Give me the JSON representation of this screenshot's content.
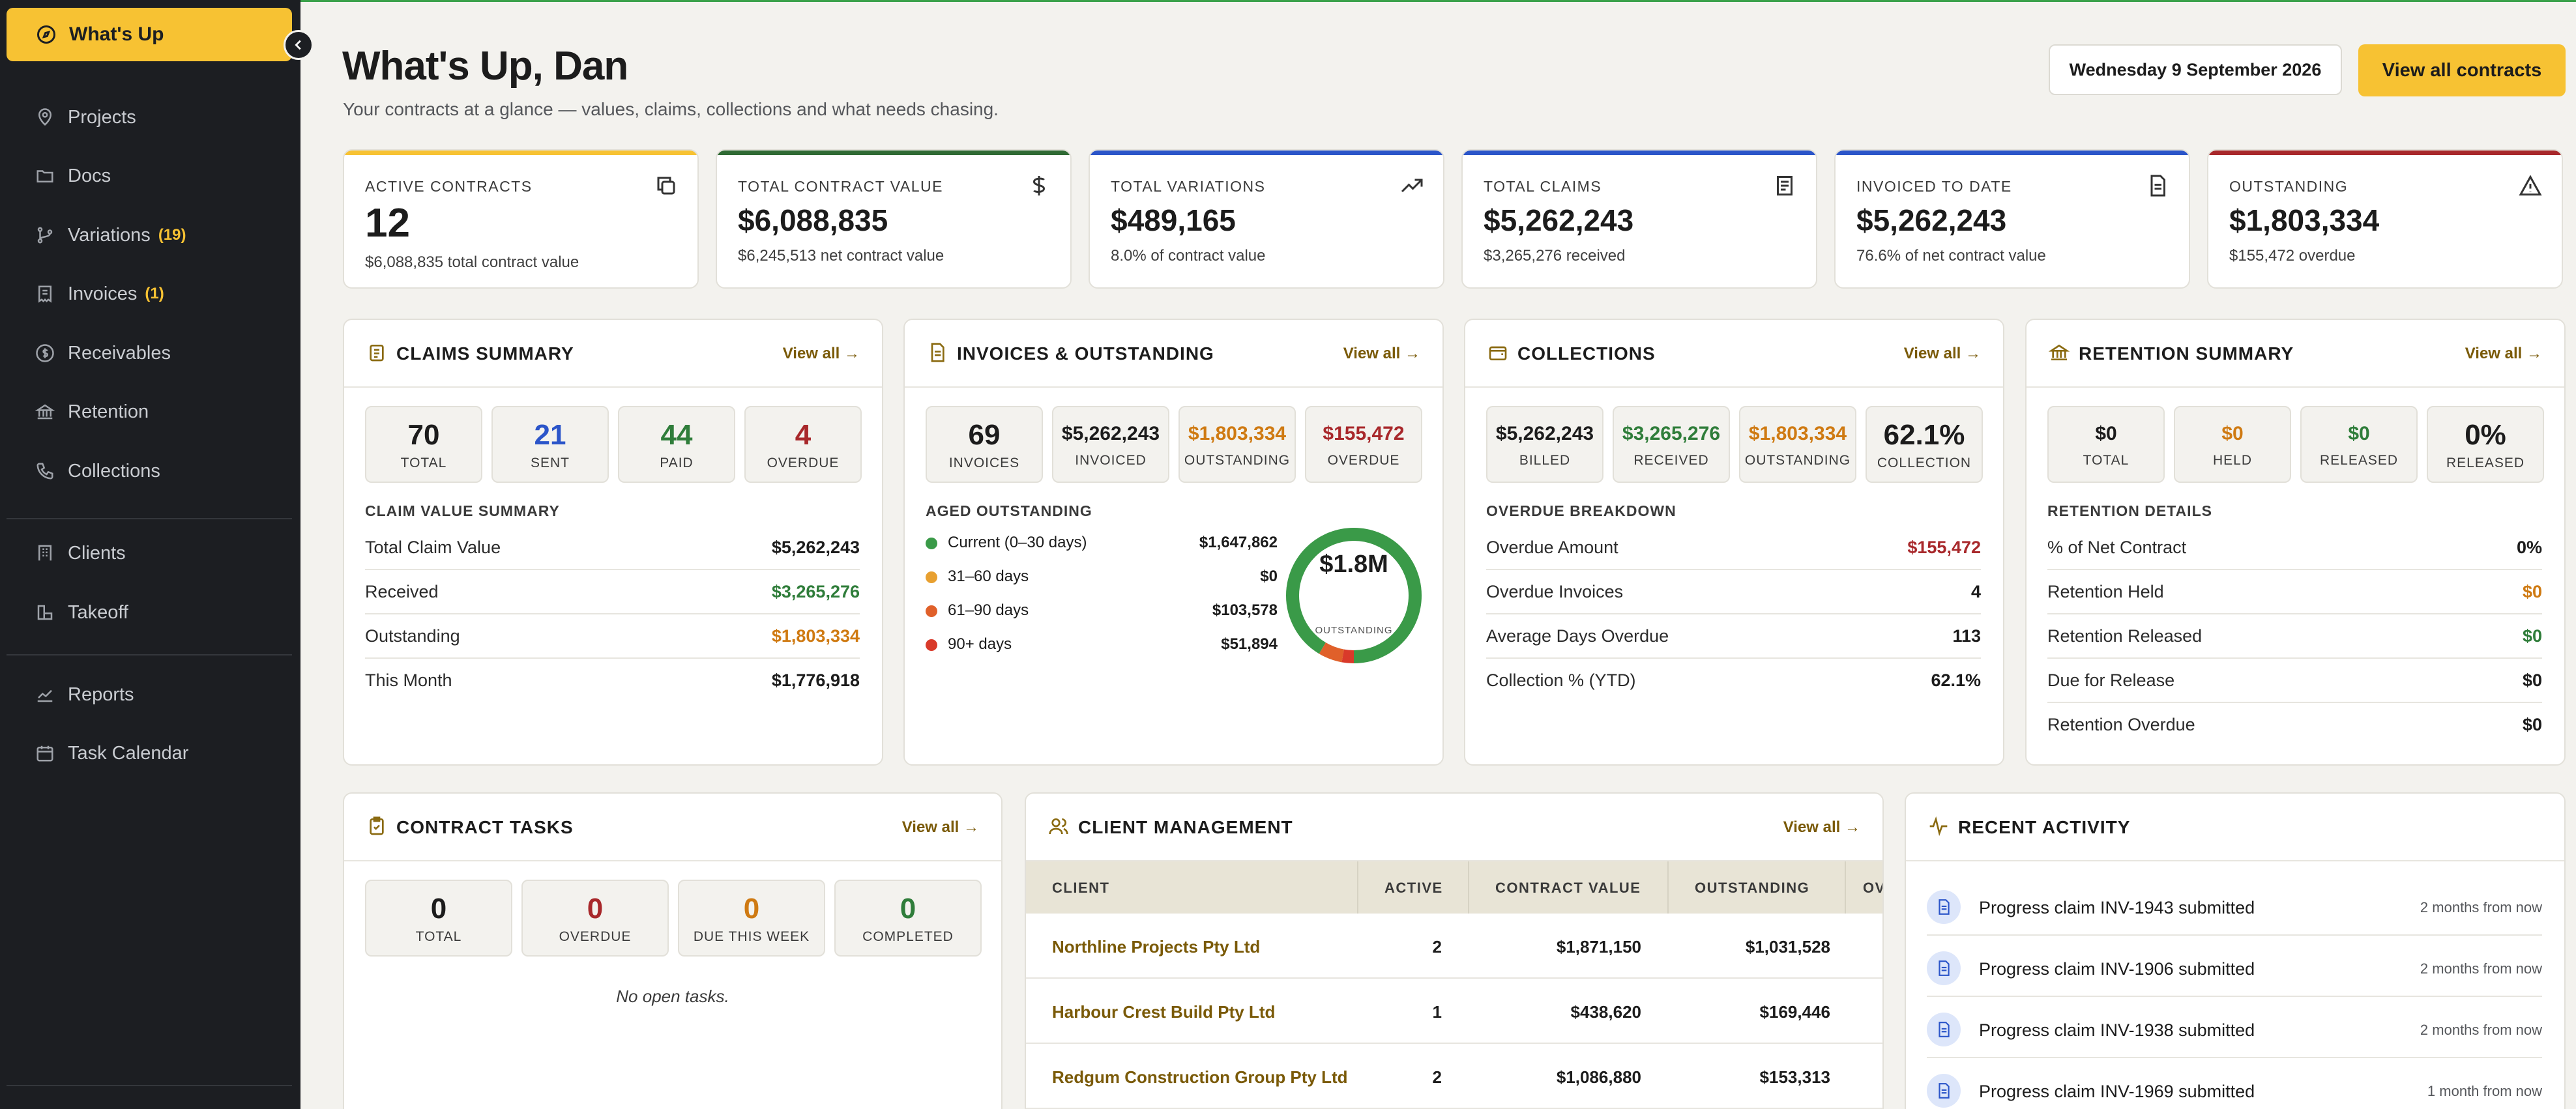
{
  "sidebar": {
    "active": {
      "label": "What's Up",
      "icon": "compass-icon"
    },
    "items": [
      {
        "label": "Projects",
        "icon": "map-pin-icon",
        "badge": ""
      },
      {
        "label": "Docs",
        "icon": "folder-icon",
        "badge": ""
      },
      {
        "label": "Variations",
        "icon": "git-branch-icon",
        "badge": "(19)"
      },
      {
        "label": "Invoices",
        "icon": "receipt-icon",
        "badge": "(1)"
      },
      {
        "label": "Receivables",
        "icon": "dollar-circle-icon",
        "badge": ""
      },
      {
        "label": "Retention",
        "icon": "bank-icon",
        "badge": ""
      },
      {
        "label": "Collections",
        "icon": "phone-icon",
        "badge": ""
      },
      {
        "label": "Clients",
        "icon": "building-icon",
        "badge": ""
      },
      {
        "label": "Takeoff",
        "icon": "ruler-icon",
        "badge": ""
      },
      {
        "label": "Reports",
        "icon": "chart-line-icon",
        "badge": ""
      },
      {
        "label": "Task Calendar",
        "icon": "calendar-icon",
        "badge": ""
      }
    ]
  },
  "header": {
    "title": "What's Up, Dan",
    "subtitle": "Your contracts at a glance — values, claims, collections and what needs chasing.",
    "date": "Wednesday 9 September 2026",
    "cta": "View all contracts"
  },
  "stats": [
    {
      "label": "ACTIVE CONTRACTS",
      "value": "12",
      "sub": "$6,088,835 total contract value",
      "color": "#f7c233"
    },
    {
      "label": "TOTAL CONTRACT VALUE",
      "value": "$6,088,835",
      "sub": "$6,245,513 net contract value",
      "color": "#2f6a34"
    },
    {
      "label": "TOTAL VARIATIONS",
      "value": "$489,165",
      "sub": "8.0% of contract value",
      "color": "#2b55c9"
    },
    {
      "label": "TOTAL CLAIMS",
      "value": "$5,262,243",
      "sub": "$3,265,276 received",
      "color": "#2b55c9"
    },
    {
      "label": "INVOICED TO DATE",
      "value": "$5,262,243",
      "sub": "76.6% of net contract value",
      "color": "#2b55c9"
    },
    {
      "label": "OUTSTANDING",
      "value": "$1,803,334",
      "sub": "$155,472 overdue",
      "color": "#a8282b"
    }
  ],
  "claims": {
    "title": "CLAIMS SUMMARY",
    "view_all": "View all →",
    "tiles": [
      {
        "n": "70",
        "c": "TOTAL"
      },
      {
        "n": "21",
        "c": "SENT"
      },
      {
        "n": "44",
        "c": "PAID"
      },
      {
        "n": "4",
        "c": "OVERDUE"
      }
    ],
    "section": "CLAIM VALUE SUMMARY",
    "rows": [
      {
        "k": "Total Claim Value",
        "v": "$5,262,243"
      },
      {
        "k": "Received",
        "v": "$3,265,276"
      },
      {
        "k": "Outstanding",
        "v": "$1,803,334"
      },
      {
        "k": "This Month",
        "v": "$1,776,918"
      }
    ]
  },
  "invoices": {
    "title": "INVOICES & OUTSTANDING",
    "view_all": "View all →",
    "tiles": [
      {
        "n": "69",
        "c": "INVOICES"
      },
      {
        "n": "$5,262,243",
        "c": "INVOICED"
      },
      {
        "n": "$1,803,334",
        "c": "OUTSTANDING"
      },
      {
        "n": "$155,472",
        "c": "OVERDUE"
      }
    ],
    "section": "AGED OUTSTANDING",
    "aged": [
      {
        "k": "Current (0–30 days)",
        "v": "$1,647,862",
        "color": "#3a9a48"
      },
      {
        "k": "31–60 days",
        "v": "$0",
        "color": "#e8a030"
      },
      {
        "k": "61–90 days",
        "v": "$103,578",
        "color": "#e0602a"
      },
      {
        "k": "90+ days",
        "v": "$51,894",
        "color": "#d93a2a"
      }
    ],
    "donut_value": "$1.8M",
    "donut_label": "OUTSTANDING"
  },
  "collections": {
    "title": "COLLECTIONS",
    "view_all": "View all →",
    "tiles": [
      {
        "n": "$5,262,243",
        "c": "BILLED"
      },
      {
        "n": "$3,265,276",
        "c": "RECEIVED"
      },
      {
        "n": "$1,803,334",
        "c": "OUTSTANDING"
      },
      {
        "n": "62.1%",
        "c": "COLLECTION"
      }
    ],
    "section": "OVERDUE BREAKDOWN",
    "rows": [
      {
        "k": "Overdue Amount",
        "v": "$155,472"
      },
      {
        "k": "Overdue Invoices",
        "v": "4"
      },
      {
        "k": "Average Days Overdue",
        "v": "113"
      },
      {
        "k": "Collection % (YTD)",
        "v": "62.1%"
      }
    ]
  },
  "retention": {
    "title": "RETENTION SUMMARY",
    "view_all": "View all →",
    "tiles": [
      {
        "n": "$0",
        "c": "TOTAL"
      },
      {
        "n": "$0",
        "c": "HELD"
      },
      {
        "n": "$0",
        "c": "RELEASED"
      },
      {
        "n": "0%",
        "c": "RELEASED"
      }
    ],
    "section": "RETENTION DETAILS",
    "rows": [
      {
        "k": "% of Net Contract",
        "v": "0%"
      },
      {
        "k": "Retention Held",
        "v": "$0"
      },
      {
        "k": "Retention Released",
        "v": "$0"
      },
      {
        "k": "Due for Release",
        "v": "$0"
      },
      {
        "k": "Retention Overdue",
        "v": "$0"
      }
    ]
  },
  "tasks": {
    "title": "CONTRACT TASKS",
    "view_all": "View all →",
    "tiles": [
      {
        "n": "0",
        "c": "TOTAL"
      },
      {
        "n": "0",
        "c": "OVERDUE"
      },
      {
        "n": "0",
        "c": "DUE THIS WEEK"
      },
      {
        "n": "0",
        "c": "COMPLETED"
      }
    ],
    "empty": "No open tasks."
  },
  "clients": {
    "title": "CLIENT MANAGEMENT",
    "view_all": "View all →",
    "columns": [
      "CLIENT",
      "ACTIVE",
      "CONTRACT VALUE",
      "OUTSTANDING",
      "OV"
    ],
    "rows": [
      {
        "client": "Northline Projects Pty Ltd",
        "active": "2",
        "value": "$1,871,150",
        "outstanding": "$1,031,528"
      },
      {
        "client": "Harbour Crest Build Pty Ltd",
        "active": "1",
        "value": "$438,620",
        "outstanding": "$169,446"
      },
      {
        "client": "Redgum Construction Group Pty Ltd",
        "active": "2",
        "value": "$1,086,880",
        "outstanding": "$153,313"
      }
    ]
  },
  "activity": {
    "title": "RECENT ACTIVITY",
    "items": [
      {
        "t": "Progress claim INV-1943 submitted",
        "w": "2 months from now"
      },
      {
        "t": "Progress claim INV-1906 submitted",
        "w": "2 months from now"
      },
      {
        "t": "Progress claim INV-1938 submitted",
        "w": "2 months from now"
      },
      {
        "t": "Progress claim INV-1969 submitted",
        "w": "1 month from now"
      }
    ]
  },
  "aged_fractions": {
    "current": 0.914,
    "d31_60": 0,
    "d61_90": 0.057,
    "d90_plus": 0.029
  }
}
